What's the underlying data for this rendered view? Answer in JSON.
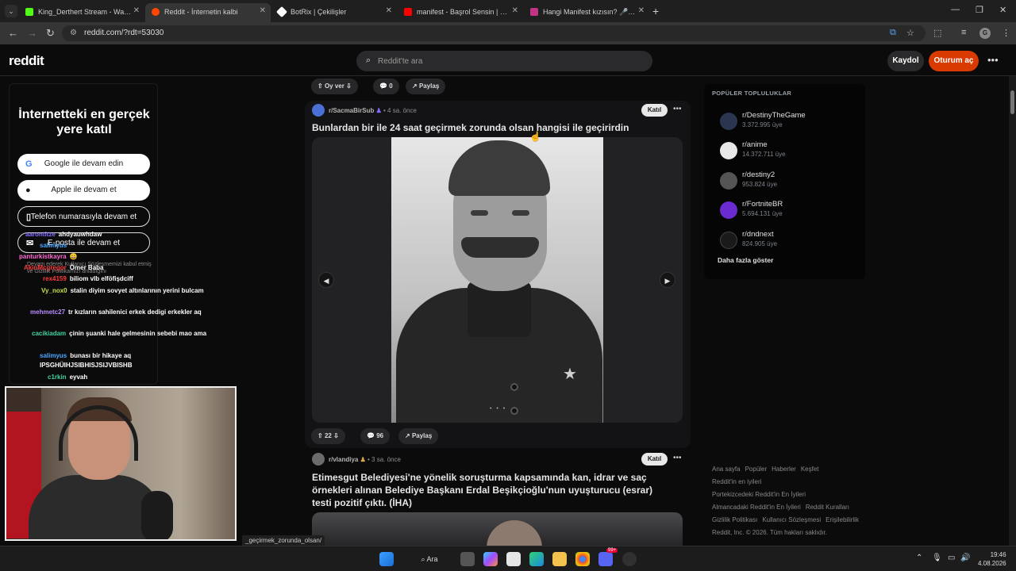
{
  "browser": {
    "tabs": [
      {
        "title": "King_Derthert Stream - Watch L",
        "color": "#53fc18"
      },
      {
        "title": "Reddit - İnternetin kalbi",
        "color": "#ff4500"
      },
      {
        "title": "BotRix | Çekilişler",
        "color": "#ffffff"
      },
      {
        "title": "manifest - Başrol Sensin | Offici",
        "color": "#ff0000"
      },
      {
        "title": "Hangi Manifest kızısın? 🎤 - Te",
        "color": "#c13584"
      }
    ],
    "url": "reddit.com/?rdt=53030"
  },
  "reddit": {
    "logo": "reddit",
    "search_placeholder": "Reddit'te ara",
    "signup": "Kaydol",
    "login": "Oturum aç",
    "top_actions": {
      "vote": "Oy ver",
      "comments": "0",
      "share": "Paylaş"
    }
  },
  "login_panel": {
    "title": "İnternetteki en gerçek yere katıl",
    "buttons": [
      "Google ile devam edin",
      "Apple ile devam et",
      "Telefon numarasıyla devam et",
      "E-posta ile devam et"
    ],
    "legal": "Devam ederek Kullanıcı Sözleşmemizi kabul etmiş ve Gizlilik Politikamızı anladığını"
  },
  "chat": [
    {
      "user": "aarontitze",
      "msg": "ahdyauwhdaw",
      "color": "#8a6cff"
    },
    {
      "user": "salimyus",
      "msg": "",
      "color": "#4aa8ff"
    },
    {
      "user": "panturkistkayra",
      "msg": "😀",
      "color": "#ff6bd3"
    },
    {
      "user": "AkinMcgregor",
      "msg": "Ömer Baba",
      "color": "#ff3b3b"
    },
    {
      "user": "rex4159",
      "msg": "biliom vlb elföfişdciff",
      "color": "#ff3b3b"
    },
    {
      "user": "Vy_nox0",
      "msg": "stalin diyim sovyet altınlarının yerini bulcam",
      "color": "#c7e04a"
    },
    {
      "user": "mehmetc27",
      "msg": "tr kızların sahilenici erkek dedigi erkekler aq",
      "color": "#b88cff"
    },
    {
      "user": "cacikiadam",
      "msg": "çinin şuanki hale gelmesinin sebebi mao ama",
      "color": "#3ed3a0"
    },
    {
      "user": "salimyus",
      "msg": "bunası bir hikaye aq IPSGHÜIHJSIBHISJSIJVBISHB",
      "color": "#4aa8ff"
    },
    {
      "user": "c1rkin",
      "msg": "eyvah",
      "color": "#3ed3a0"
    }
  ],
  "posts": [
    {
      "sub": "r/SacmaBirSub",
      "time": "4 sa. önce",
      "join": "Katıl",
      "title": "Bunlardan bir ile 24 saat geçirmek zorunda olsan hangisi ile geçirirdin",
      "votes": "22",
      "comments": "96",
      "share": "Paylaş"
    },
    {
      "sub": "r/vlandiya",
      "time": "3 sa. önce",
      "join": "Katıl",
      "title": "Etimesgut Belediyesi'ne yönelik soruşturma kapsamında kan, idrar ve saç örnekleri alınan Belediye Başkanı Erdal Beşikçioğlu'nun uyuşturucu (esrar) testi pozitif çıktı. (İHA)"
    }
  ],
  "sidebar": {
    "header": "POPÜLER TOPLULUKLAR",
    "communities": [
      {
        "name": "r/DestinyTheGame",
        "members": "3.372.995 üye",
        "color": "#2a3550"
      },
      {
        "name": "r/anime",
        "members": "14.372.711 üye",
        "color": "#e8e8e8"
      },
      {
        "name": "r/destiny2",
        "members": "953.824 üye",
        "color": "#555"
      },
      {
        "name": "r/FortniteBR",
        "members": "5.694.131 üye",
        "color": "#6a2bd1"
      },
      {
        "name": "r/dndnext",
        "members": "824.905 üye",
        "color": "#1a1a1a"
      }
    ],
    "more": "Daha fazla göster",
    "footer_lines": [
      [
        "Ana sayfa",
        "Popüler",
        "Haberler",
        "Keşfet"
      ],
      [
        "Reddit'in en iyileri"
      ],
      [
        "Portekizcedeki Reddit'in En İyileri"
      ],
      [
        "Almancadaki Reddit'in En İyileri",
        "Reddit Kuralları"
      ],
      [
        "Gizlilik Politikası",
        "Kullanıcı Sözleşmesi",
        "Erişilebilirlik"
      ],
      [
        "Reddit, Inc. © 2026. Tüm hakları saklıdır."
      ]
    ]
  },
  "status_url": "_geçirmek_zorunda_olsan/",
  "taskbar": {
    "search": "Ara",
    "time": "19:46",
    "date": "4.08.2026",
    "badge": "99+"
  }
}
